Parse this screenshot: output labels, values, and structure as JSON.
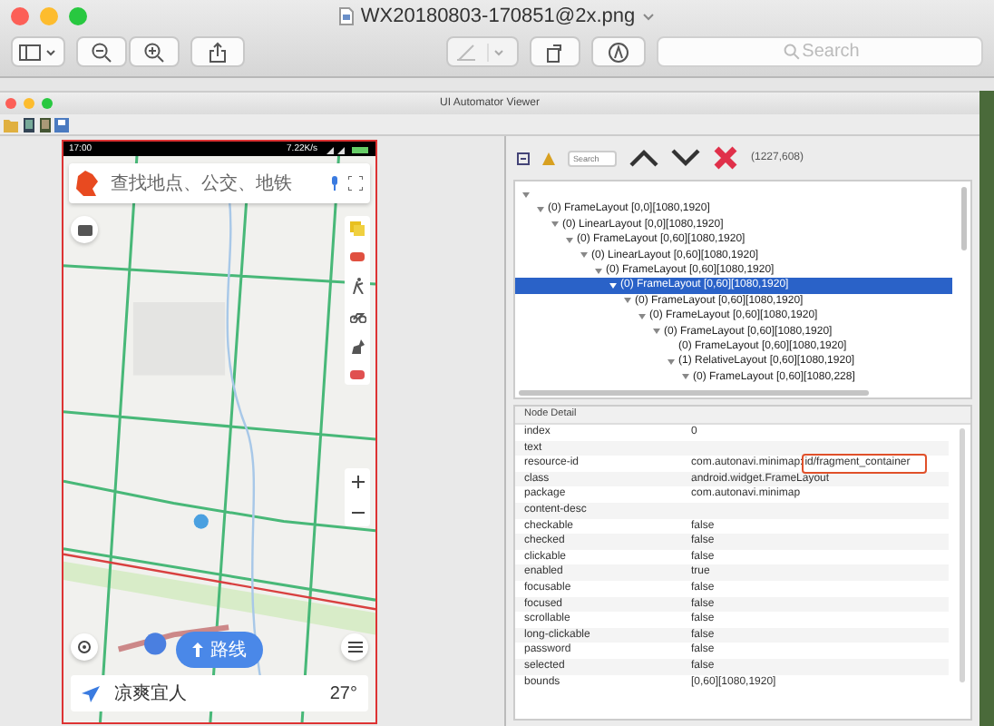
{
  "window": {
    "title": "WX20180803-170851@2x.png"
  },
  "toolbar": {
    "search": {
      "placeholder": "Search"
    }
  },
  "viewer": {
    "title": "UI Automator Viewer",
    "phone": {
      "status_time": "17:00",
      "status_speed": "7.22K/s",
      "search_placeholder": "查找地点、公交、地铁",
      "route_button": "路线",
      "weather_text": "凉爽宜人",
      "temperature": "27°"
    },
    "tree_toolbar": {
      "search_placeholder": "Search",
      "coordinates": "(1227,608)"
    },
    "tree": {
      "expanded": true,
      "children": [
        {
          "label": "(0) FrameLayout [0,0][1080,1920]",
          "expanded": true,
          "selected": false,
          "children": [
            {
              "label": "(0) LinearLayout [0,0][1080,1920]",
              "expanded": true,
              "selected": false,
              "children": [
                {
                  "label": "(0) FrameLayout [0,60][1080,1920]",
                  "expanded": true,
                  "selected": false,
                  "children": [
                    {
                      "label": "(0) LinearLayout [0,60][1080,1920]",
                      "expanded": true,
                      "selected": false,
                      "children": [
                        {
                          "label": "(0) FrameLayout [0,60][1080,1920]",
                          "expanded": true,
                          "selected": false,
                          "children": [
                            {
                              "label": "(0) FrameLayout [0,60][1080,1920]",
                              "expanded": true,
                              "selected": true,
                              "children": [
                                {
                                  "label": "(0) FrameLayout [0,60][1080,1920]",
                                  "expanded": true,
                                  "selected": false,
                                  "children": [
                                    {
                                      "label": "(0) FrameLayout [0,60][1080,1920]",
                                      "expanded": true,
                                      "selected": false,
                                      "children": [
                                        {
                                          "label": "(0) FrameLayout [0,60][1080,1920]",
                                          "expanded": true,
                                          "selected": false,
                                          "children": [
                                            {
                                              "label": "(0) FrameLayout [0,60][1080,1920]",
                                              "expanded": false,
                                              "selected": false
                                            },
                                            {
                                              "label": "(1) RelativeLayout [0,60][1080,1920]",
                                              "expanded": true,
                                              "selected": false,
                                              "children": [
                                                {
                                                  "label": "(0) FrameLayout [0,60][1080,228]",
                                                  "expanded": true,
                                                  "selected": false
                                                }
                                              ]
                                            }
                                          ]
                                        }
                                      ]
                                    }
                                  ]
                                }
                              ]
                            }
                          ]
                        }
                      ]
                    }
                  ]
                }
              ]
            }
          ]
        }
      ]
    },
    "node_detail": {
      "title": "Node Detail",
      "rows": [
        {
          "key": "index",
          "value": "0",
          "highlight": ""
        },
        {
          "key": "text",
          "value": "",
          "highlight": ""
        },
        {
          "key": "resource-id",
          "value": "com.autonavi.minimap:",
          "highlight": "id/fragment_container"
        },
        {
          "key": "class",
          "value": "android.widget.FrameLayout",
          "highlight": ""
        },
        {
          "key": "package",
          "value": "com.autonavi.minimap",
          "highlight": ""
        },
        {
          "key": "content-desc",
          "value": "",
          "highlight": ""
        },
        {
          "key": "checkable",
          "value": "false",
          "highlight": ""
        },
        {
          "key": "checked",
          "value": "false",
          "highlight": ""
        },
        {
          "key": "clickable",
          "value": "false",
          "highlight": ""
        },
        {
          "key": "enabled",
          "value": "true",
          "highlight": ""
        },
        {
          "key": "focusable",
          "value": "false",
          "highlight": ""
        },
        {
          "key": "focused",
          "value": "false",
          "highlight": ""
        },
        {
          "key": "scrollable",
          "value": "false",
          "highlight": ""
        },
        {
          "key": "long-clickable",
          "value": "false",
          "highlight": ""
        },
        {
          "key": "password",
          "value": "false",
          "highlight": ""
        },
        {
          "key": "selected",
          "value": "false",
          "highlight": ""
        },
        {
          "key": "bounds",
          "value": "[0,60][1080,1920]",
          "highlight": ""
        }
      ]
    }
  }
}
